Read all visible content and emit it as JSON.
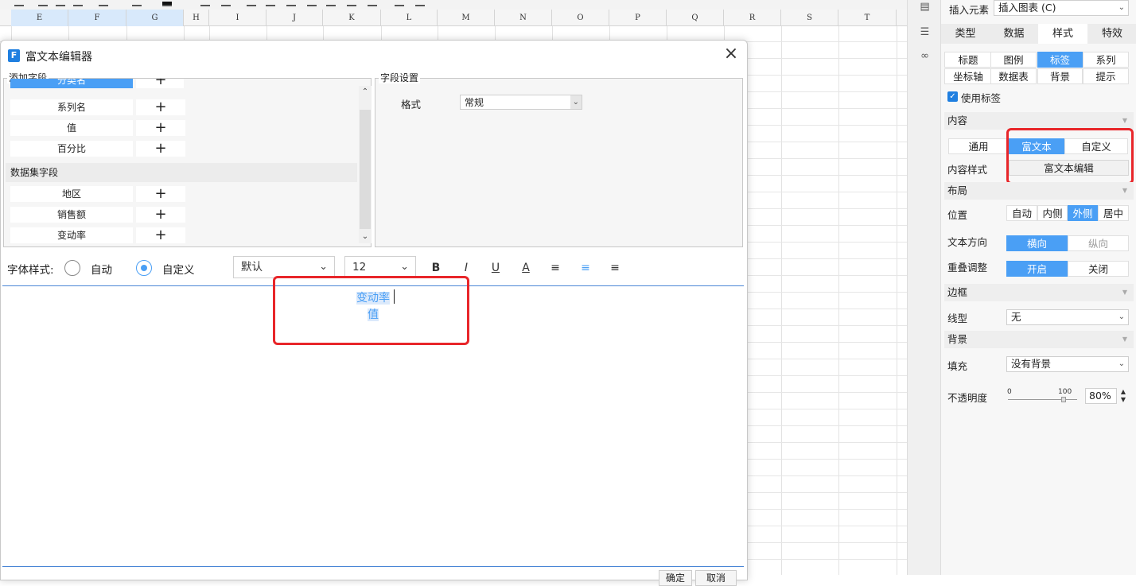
{
  "sheet": {
    "columns": [
      "E",
      "F",
      "G",
      "H",
      "I",
      "J",
      "K",
      "L",
      "M",
      "N",
      "O",
      "P",
      "Q",
      "R",
      "S",
      "T"
    ]
  },
  "dialog": {
    "title": "富文本编辑器",
    "add_fields": {
      "legend": "添加字段",
      "fields": [
        "分类名",
        "系列名",
        "值",
        "百分比"
      ],
      "dataset_group": "数据集字段",
      "dataset_fields": [
        "地区",
        "销售额",
        "变动率"
      ],
      "add_symbol": "+"
    },
    "field_settings": {
      "legend": "字段设置",
      "format_label": "格式",
      "format_value": "常规"
    },
    "font_toolbar": {
      "label": "字体样式:",
      "auto": "自动",
      "custom": "自定义",
      "font": "默认",
      "size": "12"
    },
    "editor": {
      "lines": [
        "变动率",
        "值"
      ]
    },
    "footer": {
      "ok": "确定",
      "cancel": "取消"
    }
  },
  "panel": {
    "insert_label": "插入元素",
    "insert_value": "插入图表 (C)",
    "tabs": [
      "类型",
      "数据",
      "样式",
      "特效"
    ],
    "subtabs": [
      "标题",
      "图例",
      "标签",
      "系列",
      "坐标轴",
      "数据表",
      "背景",
      "提示"
    ],
    "use_label": "使用标签",
    "content": {
      "section": "内容",
      "options": [
        "通用",
        "富文本",
        "自定义"
      ],
      "style_label": "内容样式",
      "edit_button": "富文本编辑"
    },
    "layout": {
      "section": "布局",
      "position_label": "位置",
      "position_options": [
        "自动",
        "内侧",
        "外侧",
        "居中"
      ],
      "direction_label": "文本方向",
      "direction_options": [
        "横向",
        "纵向"
      ],
      "overlap_label": "重叠调整",
      "overlap_options": [
        "开启",
        "关闭"
      ]
    },
    "border": {
      "section": "边框",
      "line_label": "线型",
      "line_value": "无"
    },
    "background": {
      "section": "背景",
      "fill_label": "填充",
      "fill_value": "没有背景"
    },
    "opacity": {
      "label": "不透明度",
      "min": "0",
      "max": "100",
      "value": "80%"
    }
  },
  "colors": {
    "accent": "#4a9ff5",
    "highlight_box": "#e8262a"
  }
}
